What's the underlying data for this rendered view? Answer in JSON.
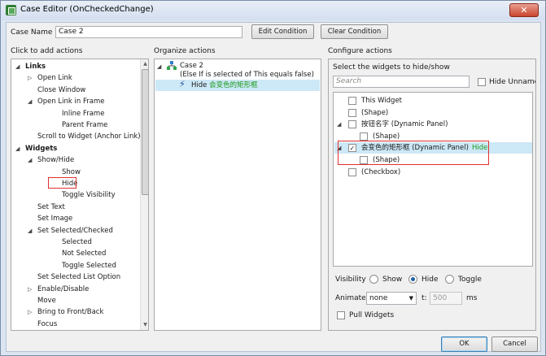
{
  "window": {
    "title": "Case Editor (OnCheckedChange)",
    "close_glyph": "✕"
  },
  "case_name": {
    "label": "Case Name",
    "value": "Case 2"
  },
  "buttons": {
    "edit_condition": "Edit Condition",
    "clear_condition": "Clear Condition",
    "ok": "OK",
    "cancel": "Cancel"
  },
  "left": {
    "header": "Click to add actions",
    "items": [
      {
        "label": "Links",
        "bold": true,
        "expander": "◢",
        "indent": 0
      },
      {
        "label": "Open Link",
        "expander": "▷",
        "indent": 1
      },
      {
        "label": "Close Window",
        "indent": 1
      },
      {
        "label": "Open Link in Frame",
        "expander": "◢",
        "indent": 1
      },
      {
        "label": "Inline Frame",
        "indent": 2
      },
      {
        "label": "Parent Frame",
        "indent": 2
      },
      {
        "label": "Scroll to Widget (Anchor Link)",
        "indent": 1
      },
      {
        "label": "Widgets",
        "bold": true,
        "expander": "◢",
        "indent": 0
      },
      {
        "label": "Show/Hide",
        "expander": "◢",
        "indent": 1
      },
      {
        "label": "Show",
        "indent": 2
      },
      {
        "label": "Hide",
        "indent": 2,
        "highlight": true
      },
      {
        "label": "Toggle Visibility",
        "indent": 2
      },
      {
        "label": "Set Text",
        "indent": 1
      },
      {
        "label": "Set Image",
        "indent": 1
      },
      {
        "label": "Set Selected/Checked",
        "expander": "◢",
        "indent": 1
      },
      {
        "label": "Selected",
        "indent": 2
      },
      {
        "label": "Not Selected",
        "indent": 2
      },
      {
        "label": "Toggle Selected",
        "indent": 2
      },
      {
        "label": "Set Selected List Option",
        "indent": 1
      },
      {
        "label": "Enable/Disable",
        "expander": "▷",
        "indent": 1
      },
      {
        "label": "Move",
        "indent": 1
      },
      {
        "label": "Bring to Front/Back",
        "expander": "▷",
        "indent": 1
      },
      {
        "label": "Focus",
        "indent": 1
      }
    ]
  },
  "middle": {
    "header": "Organize actions",
    "case_label": "Case 2",
    "condition": "(Else If is selected of This equals false)",
    "action_prefix": "Hide",
    "action_target": "会变色的矩形框"
  },
  "right": {
    "header": "Configure actions",
    "subheader": "Select the widgets to hide/show",
    "search_placeholder": "Search",
    "hide_unnamed": "Hide Unnamed",
    "widgets": [
      {
        "label": "This Widget",
        "indent": 0,
        "checked": false
      },
      {
        "label": "(Shape)",
        "indent": 0,
        "checked": false
      },
      {
        "label": "按钮名字 (Dynamic Panel)",
        "indent": 0,
        "checked": false,
        "expander": "◢"
      },
      {
        "label": "(Shape)",
        "indent": 1,
        "checked": false
      },
      {
        "label": "会变色的矩形框 (Dynamic Panel)",
        "indent": 0,
        "checked": true,
        "expander": "◢",
        "action": "Hide",
        "selected": true
      },
      {
        "label": "(Shape)",
        "indent": 1,
        "checked": false
      },
      {
        "label": "(Checkbox)",
        "indent": 0,
        "checked": false
      }
    ],
    "visibility": {
      "label": "Visibility",
      "options": [
        "Show",
        "Hide",
        "Toggle"
      ],
      "selected": "Hide"
    },
    "animate": {
      "label": "Animate",
      "value": "none",
      "t_label": "t:",
      "t_value": "500",
      "unit": "ms"
    },
    "pull_widgets": "Pull Widgets",
    "check_glyph": "✓"
  }
}
